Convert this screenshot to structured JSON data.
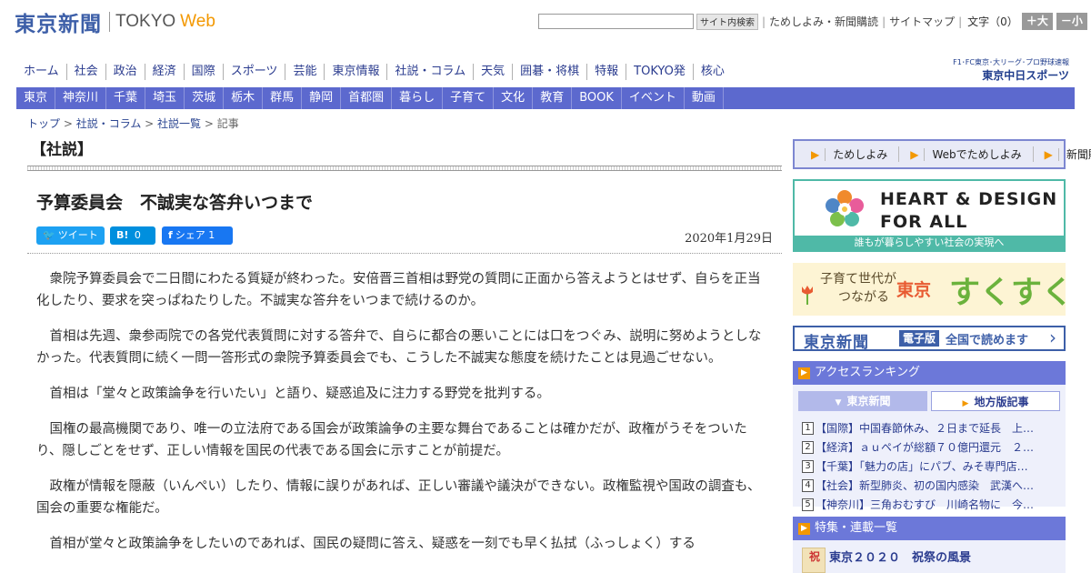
{
  "header": {
    "logo_jp": "東京新聞",
    "logo_en": "TOKYO",
    "logo_web": "Web",
    "search_placeholder": "",
    "search_button": "サイト内検索",
    "links": [
      "ためしよみ・新聞購読",
      "サイトマップ"
    ],
    "text_size_label": "文字（0）",
    "size_up": "＋大",
    "size_down": "－小"
  },
  "main_nav": [
    "ホーム",
    "社会",
    "政治",
    "経済",
    "国際",
    "スポーツ",
    "芸能",
    "東京情報",
    "社説・コラム",
    "天気",
    "囲碁・将棋",
    "特報",
    "TOKYO発",
    "核心"
  ],
  "chunichi": {
    "sub": "F1･FC東京･大リーグ･プロ野球速報",
    "main": "東京中日スポーツ"
  },
  "sub_nav": [
    "東京",
    "神奈川",
    "千葉",
    "埼玉",
    "茨城",
    "栃木",
    "群馬",
    "静岡",
    "首都圏",
    "暮らし",
    "子育て",
    "文化",
    "教育",
    "BOOK",
    "イベント",
    "動画"
  ],
  "breadcrumb": [
    "トップ",
    "社説・コラム",
    "社説一覧",
    "記事"
  ],
  "article": {
    "section": "【社説】",
    "headline": "予算委員会　不誠実な答弁いつまで",
    "date": "2020年1月29日",
    "share": {
      "tweet": "ツイート",
      "hatena_icon": "B!",
      "hatena_count": "0",
      "fb_share": "シェア",
      "fb_count": "1"
    },
    "paragraphs": [
      "衆院予算委員会で二日間にわたる質疑が終わった。安倍晋三首相は野党の質問に正面から答えようとはせず、自らを正当化したり、要求を突っぱねたりした。不誠実な答弁をいつまで続けるのか。",
      "首相は先週、衆参両院での各党代表質問に対する答弁で、自らに都合の悪いことには口をつぐみ、説明に努めようとしなかった。代表質問に続く一問一答形式の衆院予算委員会でも、こうした不誠実な態度を続けたことは見過ごせない。",
      "首相は「堂々と政策論争を行いたい」と語り、疑惑追及に注力する野党を批判する。",
      "国権の最高機関であり、唯一の立法府である国会が政策論争の主要な舞台であることは確かだが、政権がうそをついたり、隠しごとをせず、正しい情報を国民の代表である国会に示すことが前提だ。",
      "政権が情報を隠蔽（いんぺい）したり、情報に誤りがあれば、正しい審議や議決ができない。政権監視や国政の調査も、国会の重要な権能だ。",
      "首相が堂々と政策論争をしたいのであれば、国民の疑問に答え、疑惑を一刻でも早く払拭（ふっしょく）する"
    ]
  },
  "sidebar": {
    "links": [
      "ためしよみ",
      "Webでためしよみ",
      "新聞購読"
    ],
    "hd_banner": {
      "line1": "HEART & DESIGN",
      "line2": "FOR ALL",
      "foot": "誰もが暮らしやすい社会の実現へ"
    },
    "suku_banner": {
      "line1": "子育て世代が",
      "line2": "つながる",
      "tokyo": "東京",
      "suku": "すくすく"
    },
    "ep_banner": {
      "logo": "東京新聞",
      "badge": "電子版",
      "text": "全国で読めます"
    },
    "ranking": {
      "title": "アクセスランキング",
      "tabs": [
        "東京新聞",
        "地方版記事"
      ],
      "items": [
        {
          "num": "1",
          "text": "【国際】中国春節休み、２日まで延長　上…"
        },
        {
          "num": "2",
          "text": "【経済】ａｕペイが総額７０億円還元　２…"
        },
        {
          "num": "3",
          "text": "【千葉】「魅力の店」にパブ、みそ専門店…"
        },
        {
          "num": "4",
          "text": "【社会】新型肺炎、初の国内感染　武漢へ…"
        },
        {
          "num": "5",
          "text": "【神奈川】三角おむすび　川崎名物に　今…"
        }
      ]
    },
    "features": {
      "title": "特集・連載一覧",
      "item_icon_text": "祝",
      "item_title": "東京２０２０　祝祭の風景"
    }
  },
  "colors": {
    "nav_blue": "#5c69ce",
    "logo_blue": "#3d5fa8",
    "accent_orange": "#f39800",
    "teal": "#4fb9a7"
  }
}
